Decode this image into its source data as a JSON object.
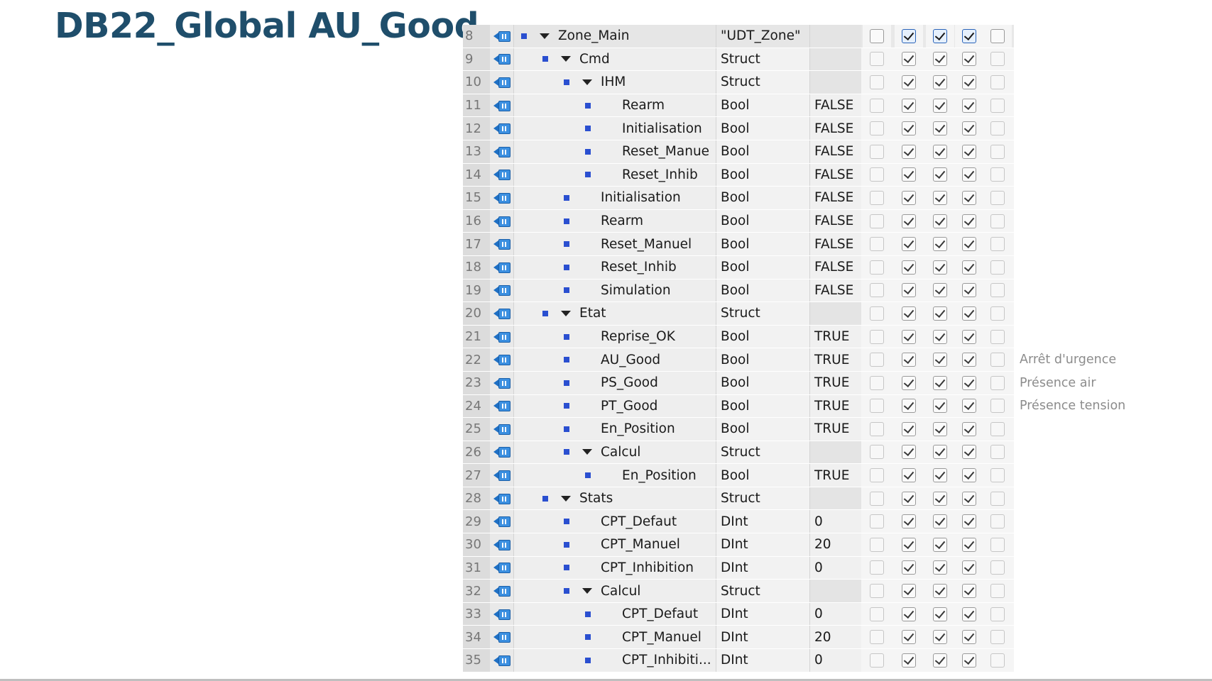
{
  "slide": {
    "title": "DB22_Global AU_Good"
  },
  "rows": [
    {
      "num": "8",
      "level": 0,
      "expander": true,
      "name": "Zone_Main",
      "type": "\"UDT_Zone\"",
      "value": "",
      "cb": [
        false,
        true,
        true,
        true,
        false
      ],
      "comment": "",
      "zone": true
    },
    {
      "num": "9",
      "level": 1,
      "expander": true,
      "name": "Cmd",
      "type": "Struct",
      "value": "",
      "cb": [
        false,
        true,
        true,
        true,
        false
      ],
      "comment": ""
    },
    {
      "num": "10",
      "level": 2,
      "expander": true,
      "name": "IHM",
      "type": "Struct",
      "value": "",
      "cb": [
        false,
        true,
        true,
        true,
        false
      ],
      "comment": ""
    },
    {
      "num": "11",
      "level": 3,
      "expander": false,
      "name": "Rearm",
      "type": "Bool",
      "value": "FALSE",
      "cb": [
        false,
        true,
        true,
        true,
        false
      ],
      "comment": ""
    },
    {
      "num": "12",
      "level": 3,
      "expander": false,
      "name": "Initialisation",
      "type": "Bool",
      "value": "FALSE",
      "cb": [
        false,
        true,
        true,
        true,
        false
      ],
      "comment": ""
    },
    {
      "num": "13",
      "level": 3,
      "expander": false,
      "name": "Reset_Manue",
      "type": "Bool",
      "value": "FALSE",
      "cb": [
        false,
        true,
        true,
        true,
        false
      ],
      "comment": ""
    },
    {
      "num": "14",
      "level": 3,
      "expander": false,
      "name": "Reset_Inhib",
      "type": "Bool",
      "value": "FALSE",
      "cb": [
        false,
        true,
        true,
        true,
        false
      ],
      "comment": ""
    },
    {
      "num": "15",
      "level": 2,
      "expander": false,
      "name": "Initialisation",
      "type": "Bool",
      "value": "FALSE",
      "cb": [
        false,
        true,
        true,
        true,
        false
      ],
      "comment": ""
    },
    {
      "num": "16",
      "level": 2,
      "expander": false,
      "name": "Rearm",
      "type": "Bool",
      "value": "FALSE",
      "cb": [
        false,
        true,
        true,
        true,
        false
      ],
      "comment": ""
    },
    {
      "num": "17",
      "level": 2,
      "expander": false,
      "name": "Reset_Manuel",
      "type": "Bool",
      "value": "FALSE",
      "cb": [
        false,
        true,
        true,
        true,
        false
      ],
      "comment": ""
    },
    {
      "num": "18",
      "level": 2,
      "expander": false,
      "name": "Reset_Inhib",
      "type": "Bool",
      "value": "FALSE",
      "cb": [
        false,
        true,
        true,
        true,
        false
      ],
      "comment": ""
    },
    {
      "num": "19",
      "level": 2,
      "expander": false,
      "name": "Simulation",
      "type": "Bool",
      "value": "FALSE",
      "cb": [
        false,
        true,
        true,
        true,
        false
      ],
      "comment": ""
    },
    {
      "num": "20",
      "level": 1,
      "expander": true,
      "name": "Etat",
      "type": "Struct",
      "value": "",
      "cb": [
        false,
        true,
        true,
        true,
        false
      ],
      "comment": ""
    },
    {
      "num": "21",
      "level": 2,
      "expander": false,
      "name": "Reprise_OK",
      "type": "Bool",
      "value": "TRUE",
      "cb": [
        false,
        true,
        true,
        true,
        false
      ],
      "comment": ""
    },
    {
      "num": "22",
      "level": 2,
      "expander": false,
      "name": "AU_Good",
      "type": "Bool",
      "value": "TRUE",
      "cb": [
        false,
        true,
        true,
        true,
        false
      ],
      "comment": "Arrêt d'urgence"
    },
    {
      "num": "23",
      "level": 2,
      "expander": false,
      "name": "PS_Good",
      "type": "Bool",
      "value": "TRUE",
      "cb": [
        false,
        true,
        true,
        true,
        false
      ],
      "comment": "Présence air"
    },
    {
      "num": "24",
      "level": 2,
      "expander": false,
      "name": "PT_Good",
      "type": "Bool",
      "value": "TRUE",
      "cb": [
        false,
        true,
        true,
        true,
        false
      ],
      "comment": "Présence tension"
    },
    {
      "num": "25",
      "level": 2,
      "expander": false,
      "name": "En_Position",
      "type": "Bool",
      "value": "TRUE",
      "cb": [
        false,
        true,
        true,
        true,
        false
      ],
      "comment": ""
    },
    {
      "num": "26",
      "level": 2,
      "expander": true,
      "name": "Calcul",
      "type": "Struct",
      "value": "",
      "cb": [
        false,
        true,
        true,
        true,
        false
      ],
      "comment": ""
    },
    {
      "num": "27",
      "level": 3,
      "expander": false,
      "name": "En_Position",
      "type": "Bool",
      "value": "TRUE",
      "cb": [
        false,
        true,
        true,
        true,
        false
      ],
      "comment": ""
    },
    {
      "num": "28",
      "level": 1,
      "expander": true,
      "name": "Stats",
      "type": "Struct",
      "value": "",
      "cb": [
        false,
        true,
        true,
        true,
        false
      ],
      "comment": ""
    },
    {
      "num": "29",
      "level": 2,
      "expander": false,
      "name": "CPT_Defaut",
      "type": "DInt",
      "value": "0",
      "cb": [
        false,
        true,
        true,
        true,
        false
      ],
      "comment": ""
    },
    {
      "num": "30",
      "level": 2,
      "expander": false,
      "name": "CPT_Manuel",
      "type": "DInt",
      "value": "20",
      "cb": [
        false,
        true,
        true,
        true,
        false
      ],
      "comment": ""
    },
    {
      "num": "31",
      "level": 2,
      "expander": false,
      "name": "CPT_Inhibition",
      "type": "DInt",
      "value": "0",
      "cb": [
        false,
        true,
        true,
        true,
        false
      ],
      "comment": ""
    },
    {
      "num": "32",
      "level": 2,
      "expander": true,
      "name": "Calcul",
      "type": "Struct",
      "value": "",
      "cb": [
        false,
        true,
        true,
        true,
        false
      ],
      "comment": ""
    },
    {
      "num": "33",
      "level": 3,
      "expander": false,
      "name": "CPT_Defaut",
      "type": "DInt",
      "value": "0",
      "cb": [
        false,
        true,
        true,
        true,
        false
      ],
      "comment": ""
    },
    {
      "num": "34",
      "level": 3,
      "expander": false,
      "name": "CPT_Manuel",
      "type": "DInt",
      "value": "20",
      "cb": [
        false,
        true,
        true,
        true,
        false
      ],
      "comment": ""
    },
    {
      "num": "35",
      "level": 3,
      "expander": false,
      "name": "CPT_Inhibiti...",
      "type": "DInt",
      "value": "0",
      "cb": [
        false,
        true,
        true,
        true,
        false
      ],
      "comment": ""
    }
  ]
}
